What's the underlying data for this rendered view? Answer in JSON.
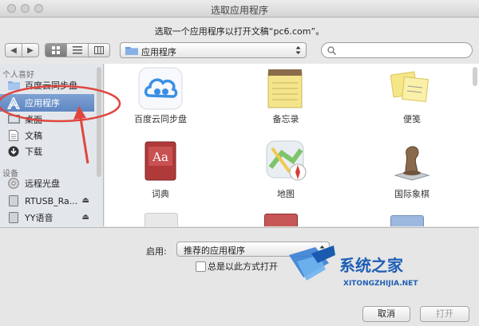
{
  "window": {
    "title": "选取应用程序",
    "prompt": "选取一个应用程序以打开文稿“pc6.com”。"
  },
  "toolbar": {
    "back_icon": "◀",
    "forward_icon": "▶",
    "location": "应用程序"
  },
  "sidebar": {
    "favorites_header": "个人喜好",
    "devices_header": "设备",
    "favorites": [
      {
        "label": "百度云同步盘",
        "icon": "folder-icon"
      },
      {
        "label": "应用程序",
        "icon": "applications-icon"
      },
      {
        "label": "桌面",
        "icon": "desktop-icon"
      },
      {
        "label": "文稿",
        "icon": "documents-icon"
      },
      {
        "label": "下载",
        "icon": "downloads-icon"
      }
    ],
    "devices": [
      {
        "label": "远程光盘",
        "icon": "remote-disc-icon"
      },
      {
        "label": "RTUSB_Ra...",
        "icon": "drive-icon",
        "eject": "⏏"
      },
      {
        "label": "YY语音",
        "icon": "drive-icon",
        "eject": "⏏"
      }
    ]
  },
  "apps": [
    {
      "label": "百度云同步盘",
      "icon": "baidu-cloud-icon"
    },
    {
      "label": "备忘录",
      "icon": "notes-icon"
    },
    {
      "label": "便笺",
      "icon": "stickies-icon"
    },
    {
      "label": "词典",
      "icon": "dictionary-icon",
      "icon_text": "Aa"
    },
    {
      "label": "地图",
      "icon": "maps-icon"
    },
    {
      "label": "国际象棋",
      "icon": "chess-icon"
    }
  ],
  "bottom": {
    "enable_label": "启用:",
    "enable_value": "推荐的应用程序",
    "always_open_label": "总是以此方式打开",
    "always_open_checked": false,
    "cancel_label": "取消",
    "open_label": "打开"
  },
  "watermark": {
    "title": "系统之家",
    "url": "XITONGZHIJIA.NET"
  },
  "colors": {
    "annotation_red": "#e0463f",
    "selection_blue": "#6b8fc8"
  }
}
